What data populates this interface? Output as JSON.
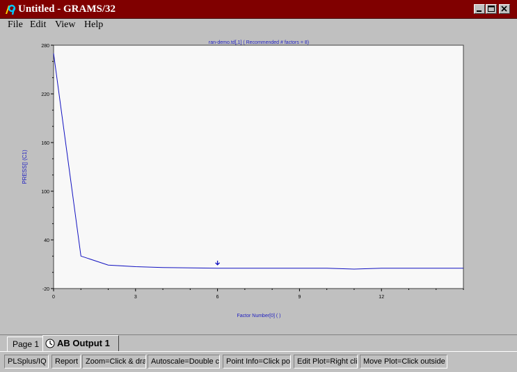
{
  "window": {
    "title": "Untitled - GRAMS/32",
    "title_color": "#800000"
  },
  "menu": {
    "items": [
      "File",
      "Edit",
      "View",
      "Help"
    ]
  },
  "chart_data": {
    "type": "line",
    "title": "ran-demo.td[,1] ( Recommended # factors = 8)",
    "xlabel": "Factor Number[0] ( )",
    "ylabel": "PRESS[] (C1)",
    "xlim": [
      0,
      15
    ],
    "ylim": [
      -20,
      280
    ],
    "xticks": [
      0,
      3,
      6,
      9,
      12
    ],
    "yticks": [
      -20,
      40,
      100,
      160,
      220,
      280
    ],
    "x": [
      0,
      1,
      2,
      3,
      4,
      5,
      6,
      7,
      8,
      9,
      10,
      11,
      12,
      13,
      14,
      15
    ],
    "series": [
      {
        "values": [
          270,
          20,
          9,
          7,
          6,
          5.5,
          5,
          5,
          5,
          5,
          5,
          4,
          5,
          5,
          5,
          5
        ],
        "color": "#1010c0"
      }
    ],
    "marker_x": 6,
    "plot_bg": "#f8f8f8",
    "grid": false
  },
  "tabs": {
    "page1": "Page 1",
    "output": "AB Output 1"
  },
  "status": {
    "cells": [
      "PLSplus/IQ",
      "Report",
      "Zoom=Click & drag",
      "Autoscale=Double click",
      "Point Info=Click point",
      "Edit Plot=Right click",
      "Move Plot=Click outside plot"
    ]
  }
}
